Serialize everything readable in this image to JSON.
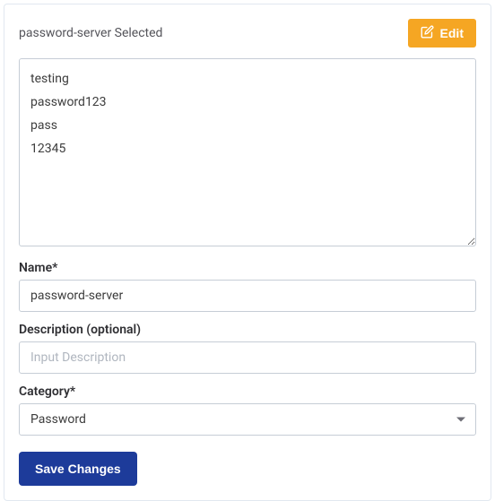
{
  "header": {
    "title": "password-server Selected",
    "edit_label": "Edit"
  },
  "content": {
    "value": "testing\npassword123\npass\n12345"
  },
  "fields": {
    "name": {
      "label": "Name*",
      "value": "password-server"
    },
    "description": {
      "label": "Description (optional)",
      "placeholder": "Input Description",
      "value": ""
    },
    "category": {
      "label": "Category*",
      "selected": "Password"
    }
  },
  "actions": {
    "save_label": "Save Changes"
  }
}
